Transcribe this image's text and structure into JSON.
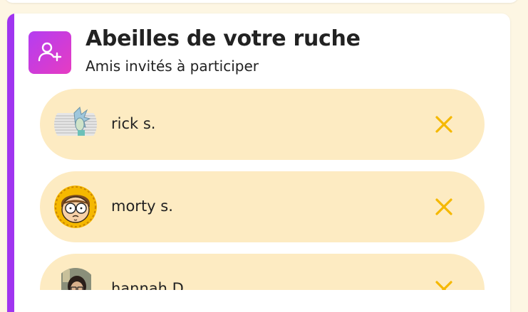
{
  "colors": {
    "page_background": "#fdf6e3",
    "accent": "#a035f0",
    "icon_gradient_start": "#b43df1",
    "icon_gradient_end": "#e63cc2",
    "row_background": "#fdebc2",
    "remove_icon": "#f5b800"
  },
  "section": {
    "icon": "add-user-icon",
    "title": "Abeilles de votre ruche",
    "subtitle": "Amis invités à participer"
  },
  "friends": [
    {
      "name": "rick s.",
      "avatar": "rick-avatar",
      "remove_icon": "close-icon"
    },
    {
      "name": "morty s.",
      "avatar": "morty-avatar",
      "remove_icon": "close-icon"
    },
    {
      "name": "hannah D.",
      "avatar": "hannah-avatar",
      "remove_icon": "close-icon"
    }
  ]
}
